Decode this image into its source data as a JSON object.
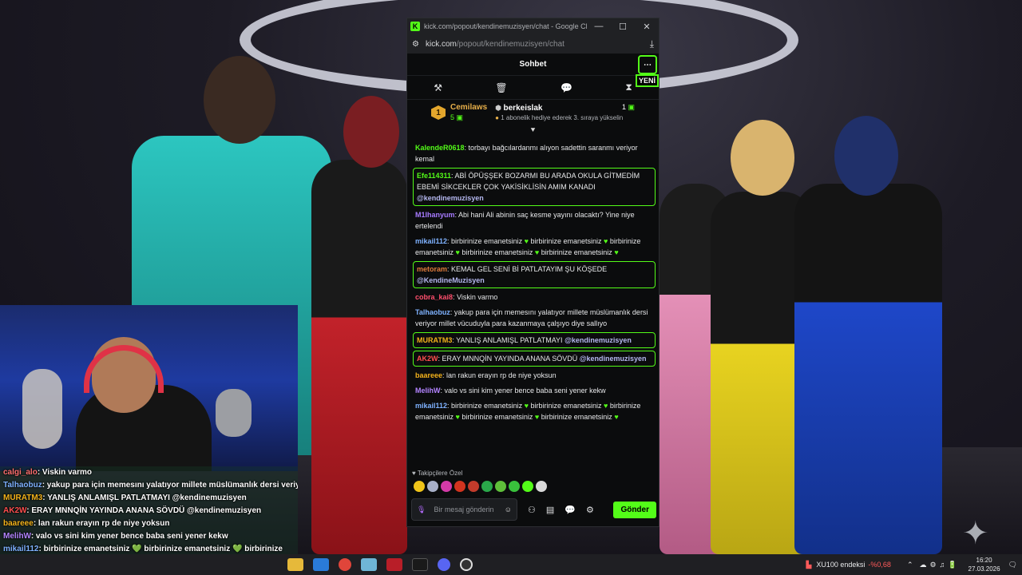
{
  "browser": {
    "window_title": "kick.com/popout/kendinemuzisyen/chat - Google Chrome",
    "url_host": "kick.com",
    "url_path": "/popout/kendinemuzisyen/chat"
  },
  "chat": {
    "header_title": "Sohbet",
    "new_badge": "YENİ",
    "leaderboard": {
      "rank": "1",
      "top_name": "Cemilaws",
      "top_count": "5",
      "second_name": "berkeislak",
      "second_count": "1",
      "gift_note": "1 abonelik hediye ederek 3. sıraya yükselin"
    },
    "messages": [
      {
        "user": "KalendeR0618",
        "text": ": torbayı bağcılardanmı alıyon sadettin saranmı veriyor kemal",
        "user_color": "#53fc18",
        "highlight": false
      },
      {
        "user": "Efe114311",
        "text": ": ABİ ÖPÜŞŞEK BOZARMI BU ARADA OKULA GİTMEDİM EBEMİ SİKCEKLER ÇOK YAKİSİKLİSİN AMIM KANADI",
        "mention": "@kendinemuzisyen",
        "user_color": "#53fc18",
        "highlight": true
      },
      {
        "user": "M1lhanyum",
        "text": ": Abi hani Ali abinin saç kesme yayını olacaktı? Yine niye ertelendi",
        "user_color": "#a77bff",
        "highlight": false
      },
      {
        "user": "mikail112",
        "text": ": birbirinize emanetsiniz 💚 birbirinize emanetsiniz 💚 birbirinize emanetsiniz 💚 birbirinize emanetsiniz 💚 birbirinize emanetsiniz 💚",
        "user_color": "#7fb2ff",
        "highlight": false
      },
      {
        "user": "metoram",
        "text": ": KEMAL GEL SENİ Bİ PATLATAYIM ŞU KÖŞEDE",
        "mention": "@KendineMuzisyen",
        "user_color": "#e07b3c",
        "highlight": true
      },
      {
        "user": "cobra_kai8",
        "text": ": Viskin varmo",
        "user_color": "#ff4f6d",
        "highlight": false
      },
      {
        "user": "Talhaobuz",
        "text": ": yakup para için memesını yalatıyor millete müslümanlık dersi veriyor millet vücuduyla para kazanmaya çalşıyo diye sallıyo",
        "user_color": "#7fb2ff",
        "highlight": false
      },
      {
        "user": "MURATM3",
        "text": ": YANLIŞ ANLAMIŞL PATLATMAYI",
        "mention": "@kendinemuzisyen",
        "user_color": "#f3b21b",
        "highlight": true
      },
      {
        "user": "AK2W",
        "text": ": ERAY MNNQİN YAYINDA ANANA SÖVDÜ",
        "mention": "@kendinemuzisyen",
        "user_color": "#ff4f4f",
        "highlight": true
      },
      {
        "user": "baareee",
        "text": ": lan rakun erayın rp de niye yoksun",
        "user_color": "#f3b21b",
        "highlight": false
      },
      {
        "user": "MelihW",
        "text": ": valo vs sini kim yener bence baba seni yener kekw",
        "user_color": "#b384ff",
        "highlight": false
      },
      {
        "user": "mikail112",
        "text": ": birbirinize emanetsiniz 💚 birbirinize emanetsiniz 💚 birbirinize emanetsiniz 💚 birbirinize emanetsiniz 💚 birbirinize emanetsiniz 💚",
        "user_color": "#7fb2ff",
        "highlight": false
      }
    ],
    "follower_note": "Takipçilere Özel",
    "input_placeholder": "Bir mesaj gönderin",
    "send_label": "Gönder"
  },
  "overlay_chat": [
    {
      "user": "calgi_alo",
      "text": ": Viskin varmo",
      "user_color": "#ff7070"
    },
    {
      "user": "Talhaobuz",
      "text": ": yakup para için memesını yalatıyor millete müslümanlık dersi veriyor millet vücuduyla para kazanmaya çalşıyo diye sallıyo",
      "user_color": "#7fb2ff"
    },
    {
      "user": "MURATM3",
      "text": ": YANLIŞ ANLAMIŞL PATLATMAYI @kendinemuzisyen",
      "user_color": "#f3b21b"
    },
    {
      "user": "AK2W",
      "text": ": ERAY MNNQİN YAYINDA ANANA SÖVDÜ @kendinemuzisyen",
      "user_color": "#ff4f4f"
    },
    {
      "user": "baareee",
      "text": ": lan rakun erayın rp de niye yoksun",
      "user_color": "#f3b21b"
    },
    {
      "user": "MelihW",
      "text": ": valo vs sini kim yener bence baba seni yener kekw",
      "user_color": "#b384ff"
    },
    {
      "user": "mikail112",
      "text": ": birbirinize emanetsiniz 💚 birbirinize emanetsiniz 💚 birbirinize",
      "user_color": "#7fb2ff"
    }
  ],
  "taskbar": {
    "stock_name": "XU100 endeksi",
    "stock_change": "-%0,68",
    "time": "16:20",
    "date": "27.03.2026"
  },
  "colors": {
    "accent": "#53fc18",
    "popup_bg": "#0b0c0d",
    "negative": "#ff5a5a"
  }
}
